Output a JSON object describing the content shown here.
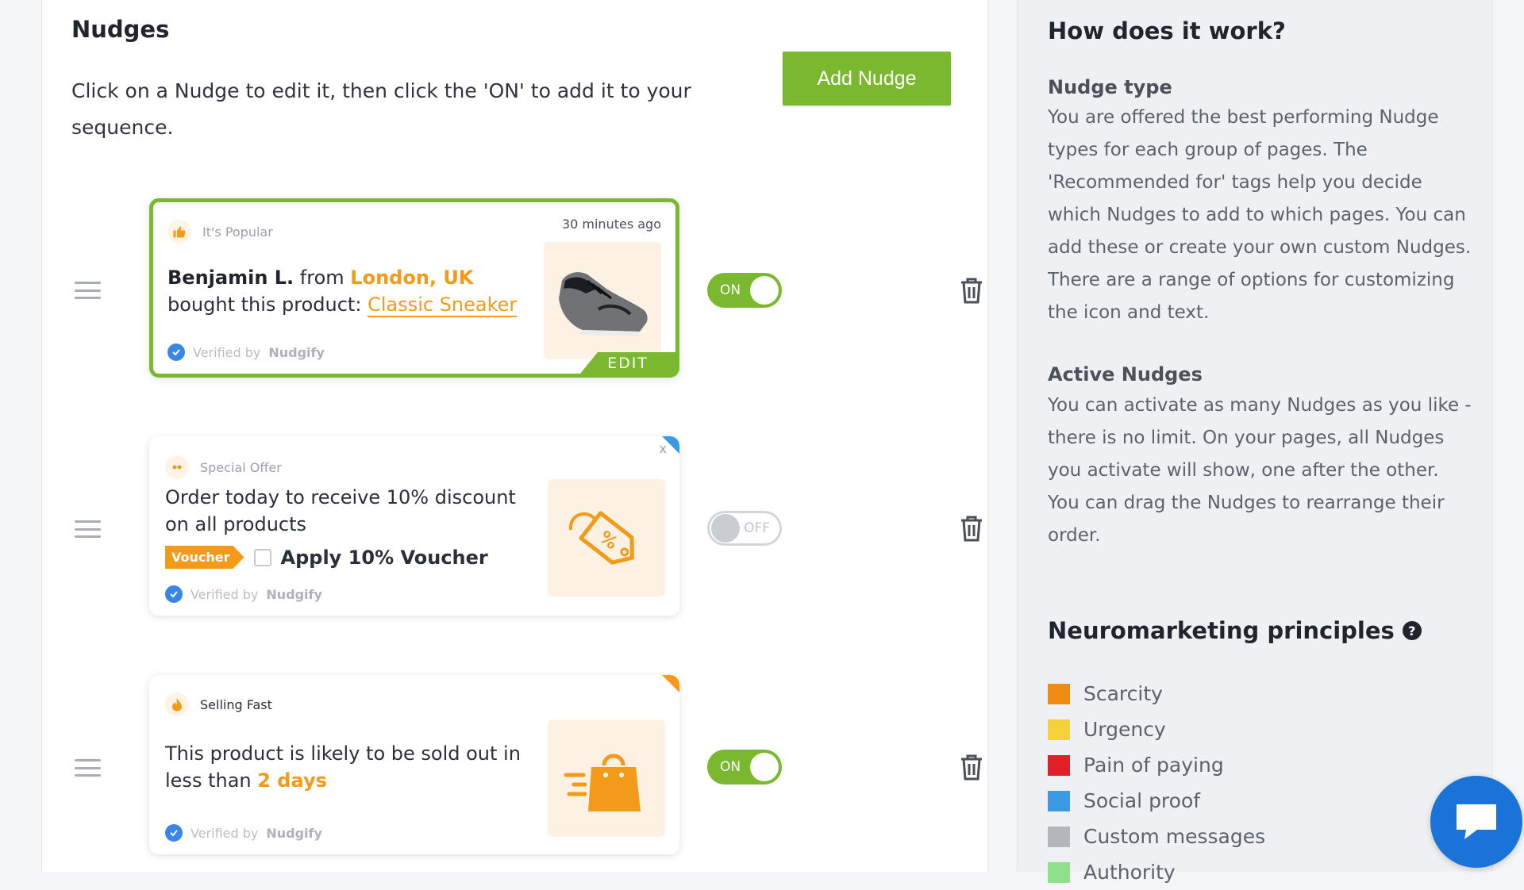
{
  "nudges_panel": {
    "title": "Nudges",
    "intro": "Click on a Nudge to edit it, then click the 'ON' to add it to your sequence.",
    "add_button": "Add Nudge"
  },
  "nudges": [
    {
      "type_label": "It's Popular",
      "type_icon": "thumbs-up-icon",
      "time": "30 minutes ago",
      "msg_name": "Benjamin L.",
      "msg_from": " from ",
      "msg_location": "London, UK",
      "msg_bought": " bought this product: ",
      "msg_product": "Classic Sneaker",
      "verified_prefix": "Verified by",
      "verified_brand": "Nudgify",
      "edit_label": "EDIT",
      "toggle_label": "ON",
      "toggle_state": "on",
      "image": "sneaker-image"
    },
    {
      "type_label": "Special Offer",
      "type_icon": "offer-icon",
      "close_label": "x",
      "msg": "Order today to receive 10% discount on all products",
      "voucher_badge": "Voucher",
      "voucher_text": "Apply 10% Voucher",
      "verified_prefix": "Verified by",
      "verified_brand": "Nudgify",
      "toggle_label": "OFF",
      "toggle_state": "off",
      "image": "discount-tag-image"
    },
    {
      "type_label": "Selling Fast",
      "type_icon": "flame-icon",
      "msg_pre": "This product is likely to be sold out in less than ",
      "msg_highlight": "2 days",
      "verified_prefix": "Verified by",
      "verified_brand": "Nudgify",
      "toggle_label": "ON",
      "toggle_state": "on",
      "image": "shopping-bag-image"
    }
  ],
  "how_it_works": {
    "title": "How does it work?",
    "nudge_type_heading": "Nudge type",
    "nudge_type_text": "You are offered the best performing Nudge types for each group of pages. The 'Recommended for' tags help you decide which Nudges to add to which pages. You can add these or create your own custom Nudges. There are a range of options for customizing the icon and text.",
    "active_heading": "Active Nudges",
    "active_text": "You can activate as many Nudges as you like - there is no limit. On your pages, all Nudges you activate will show, one after the other. You can drag the Nudges to rearrange their order."
  },
  "neuromarketing": {
    "title": "Neuromarketing principles",
    "help_glyph": "?",
    "principles": [
      {
        "label": "Scarcity",
        "color": "#f08c12"
      },
      {
        "label": "Urgency",
        "color": "#f5d13a"
      },
      {
        "label": "Pain of paying",
        "color": "#e2202a"
      },
      {
        "label": "Social proof",
        "color": "#3b9ae1"
      },
      {
        "label": "Custom messages",
        "color": "#b3b6bb"
      },
      {
        "label": "Authority",
        "color": "#8fe08a"
      }
    ]
  },
  "chat": {
    "icon": "chat-icon"
  }
}
